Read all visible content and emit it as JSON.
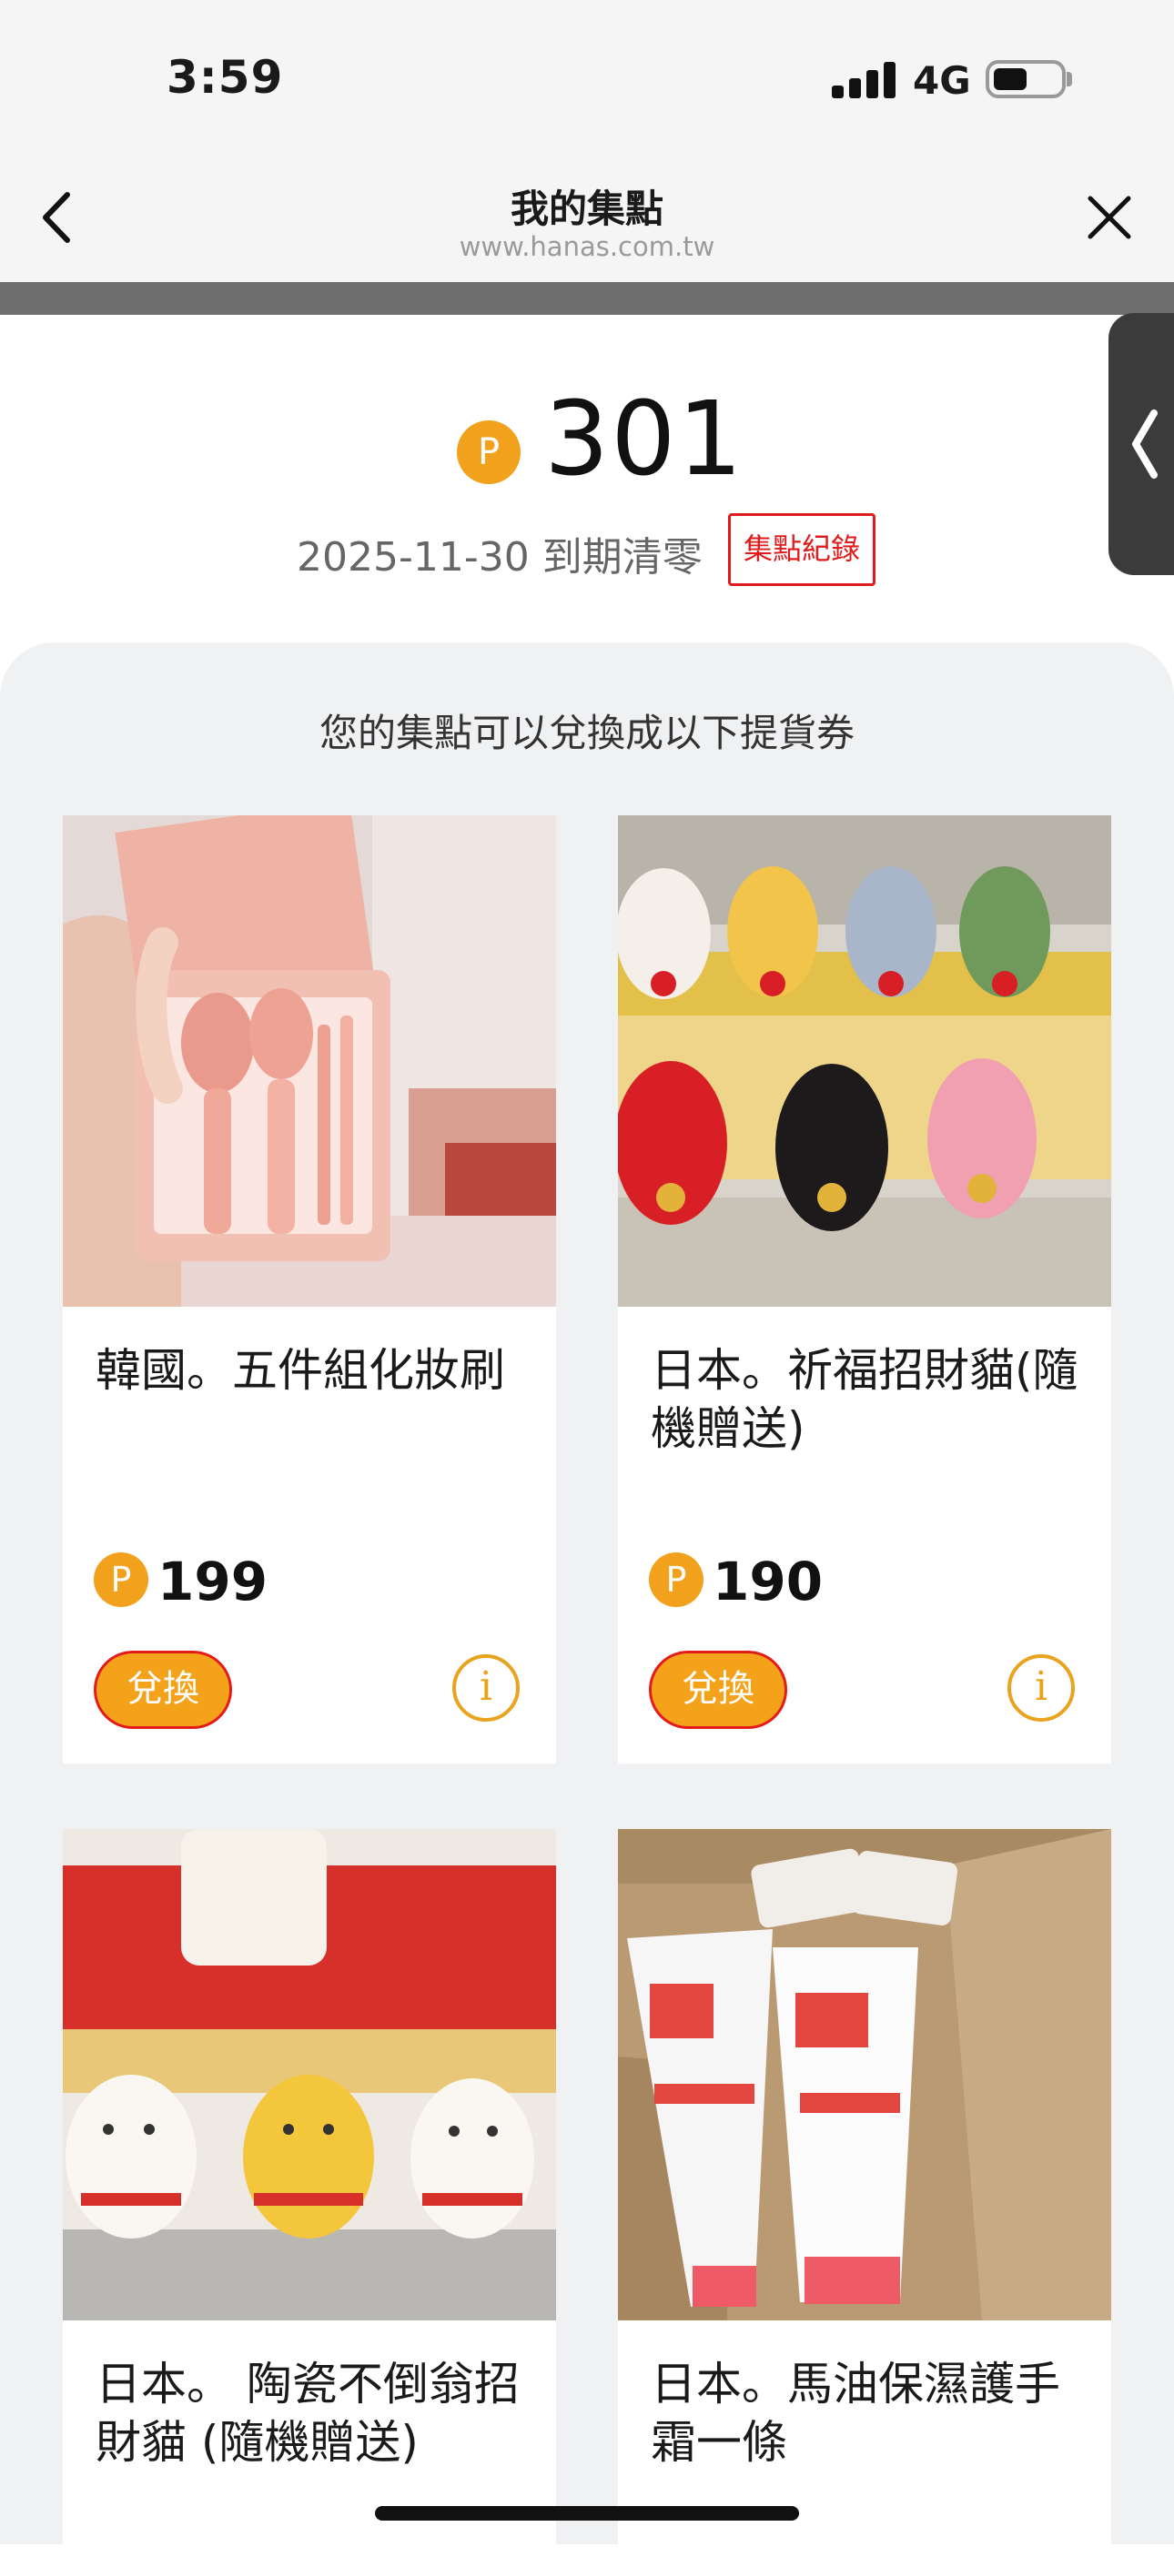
{
  "status_bar": {
    "time": "3:59",
    "network": "4G"
  },
  "nav": {
    "title": "我的集點",
    "url": "www.hanas.com.tw"
  },
  "points": {
    "badge": "P",
    "value": "301",
    "expiry": "2025-11-30 到期清零",
    "record_label": "集點紀錄"
  },
  "list": {
    "heading": "您的集點可以兌換成以下提貨券",
    "items": [
      {
        "name": "韓國。五件組化妝刷",
        "badge": "P",
        "price": "199",
        "redeem_label": "兌換",
        "info_label": "i"
      },
      {
        "name": "日本。祈福招財貓(隨機贈送)",
        "badge": "P",
        "price": "190",
        "redeem_label": "兌換",
        "info_label": "i"
      },
      {
        "name": "日本。 陶瓷不倒翁招財貓 (隨機贈送)"
      },
      {
        "name": "日本。馬油保濕護手霜一條"
      }
    ]
  },
  "colors": {
    "accent": "#f5a21b",
    "record_red": "#e01b1b",
    "panel_bg": "#f0f1f3"
  },
  "icons": [
    "back-chevron-icon",
    "close-icon",
    "side-tab-chevron-icon",
    "points-coin-icon",
    "info-icon"
  ]
}
